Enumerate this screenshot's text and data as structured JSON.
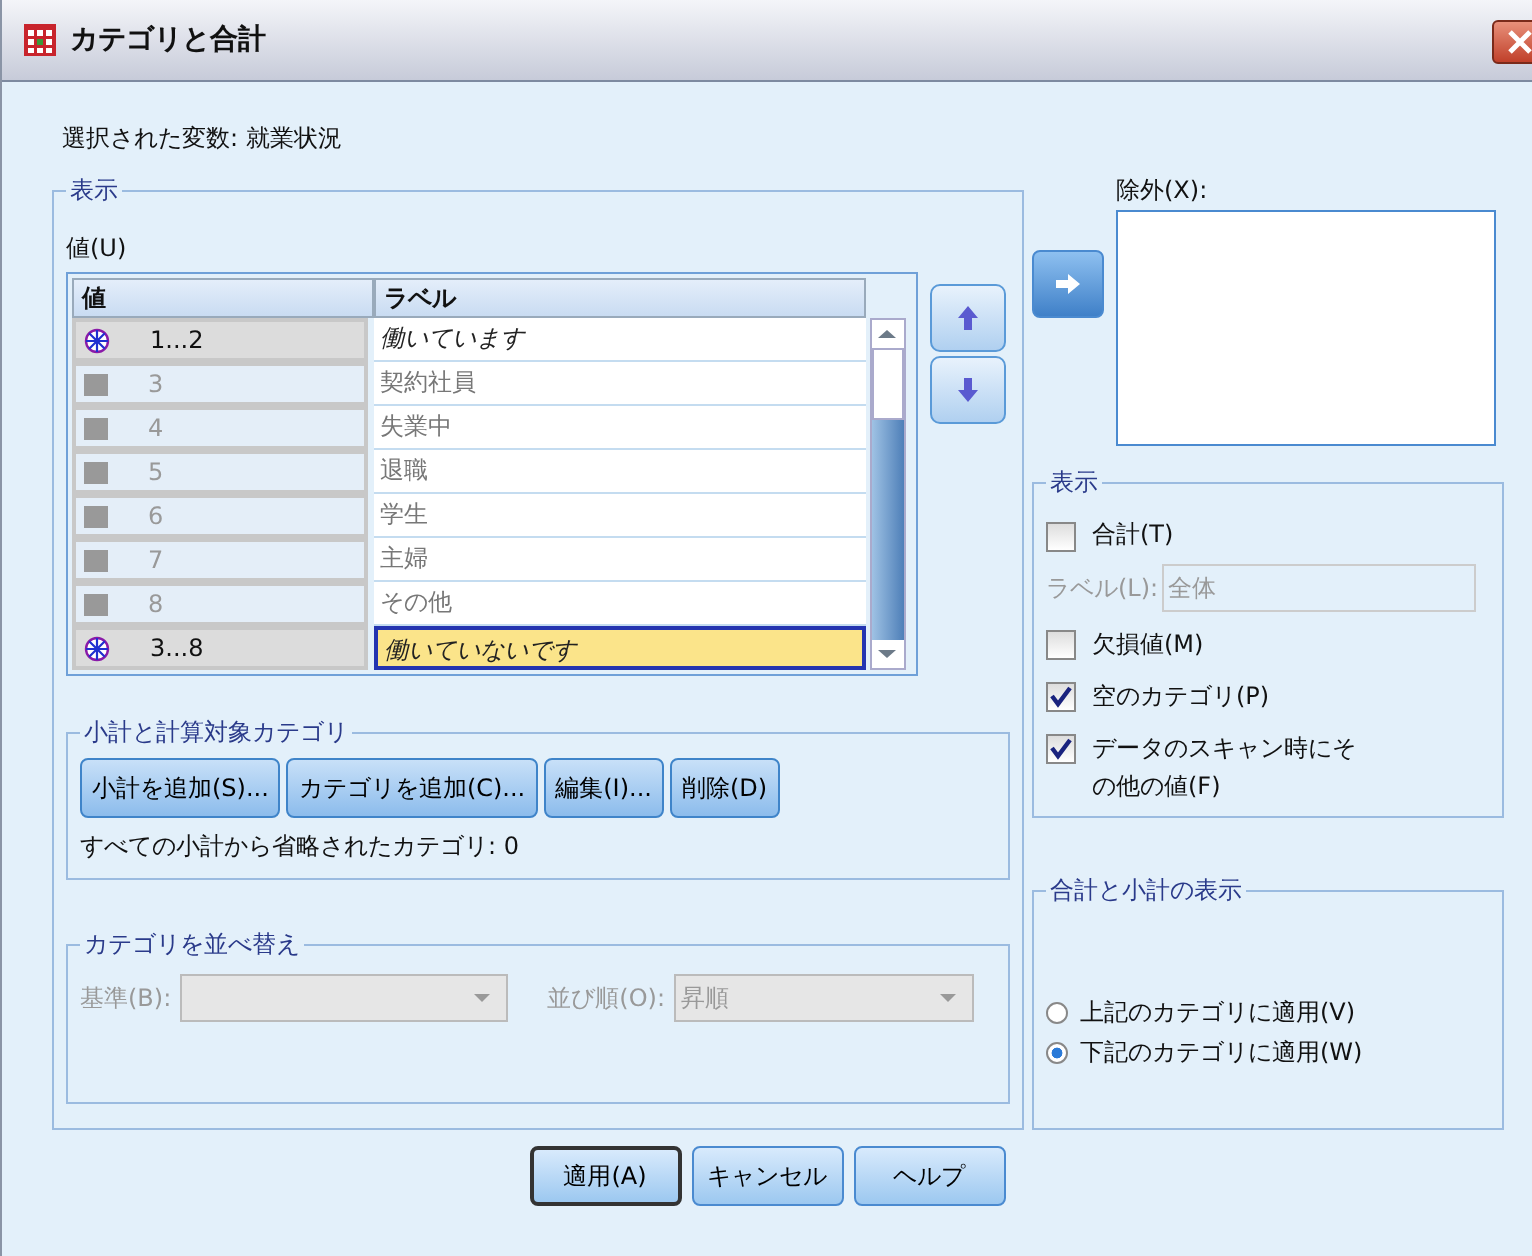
{
  "window": {
    "title": "カテゴリと合計"
  },
  "selected_variable": "選択された変数: 就業状況",
  "display_group": {
    "title": "表示",
    "values_label": "値(U)",
    "table": {
      "columns": [
        "値",
        "ラベル"
      ],
      "rows": [
        {
          "kind": "group",
          "value": "1...2",
          "label": "働いています",
          "selected": false
        },
        {
          "kind": "category",
          "value": "3",
          "label": "契約社員",
          "selected": false
        },
        {
          "kind": "category",
          "value": "4",
          "label": "失業中",
          "selected": false
        },
        {
          "kind": "category",
          "value": "5",
          "label": "退職",
          "selected": false
        },
        {
          "kind": "category",
          "value": "6",
          "label": "学生",
          "selected": false
        },
        {
          "kind": "category",
          "value": "7",
          "label": "主婦",
          "selected": false
        },
        {
          "kind": "category",
          "value": "8",
          "label": "その他",
          "selected": false
        },
        {
          "kind": "group",
          "value": "3...8",
          "label": "働いていないです",
          "selected": true
        }
      ]
    },
    "subtotals": {
      "title": "小計と計算対象カテゴリ",
      "buttons": [
        "小計を追加(S)...",
        "カテゴリを追加(C)...",
        "編集(I)...",
        "削除(D)"
      ],
      "note": "すべての小計から省略されたカテゴリ: 0"
    },
    "sort": {
      "title": "カテゴリを並べ替え",
      "disabled": true,
      "by_label": "基準(B):",
      "order_label": "並び順(O):",
      "order_value": "昇順"
    }
  },
  "exclude": {
    "label": "除外(X):"
  },
  "show": {
    "title": "表示",
    "total": {
      "label": "合計(T)",
      "checked": false
    },
    "total_label": {
      "label": "ラベル(L):",
      "value": "全体",
      "disabled": true
    },
    "options": [
      {
        "label": "欠損値(M)",
        "checked": false
      },
      {
        "label": "空のカテゴリ(P)",
        "checked": true
      },
      {
        "label": "データのスキャン時にその他の値(F)",
        "checked": true
      }
    ]
  },
  "totals_position": {
    "title": "合計と小計の表示",
    "options": [
      {
        "label": "上記のカテゴリに適用(V)",
        "selected": false
      },
      {
        "label": "下記のカテゴリに適用(W)",
        "selected": true
      }
    ]
  },
  "buttons": [
    {
      "label": "適用(A)",
      "default": true
    },
    {
      "label": "キャンセル",
      "default": false
    },
    {
      "label": "ヘルプ",
      "default": false
    }
  ]
}
